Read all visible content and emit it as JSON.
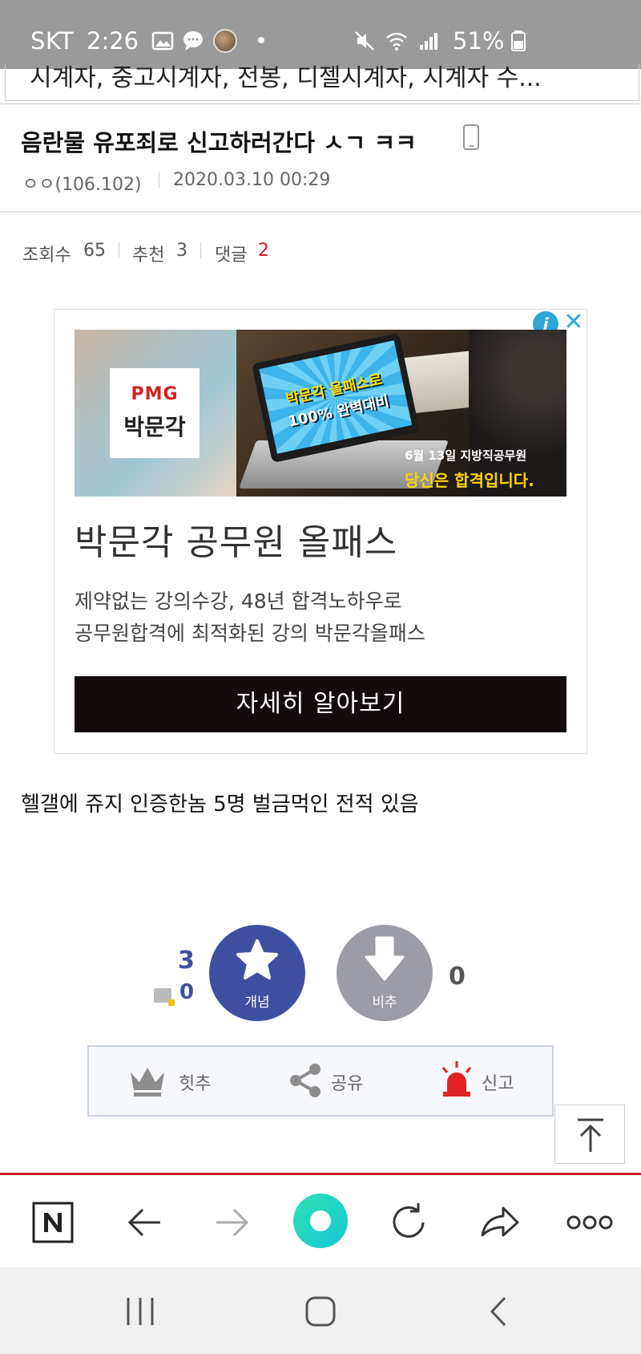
{
  "status_bar": {
    "carrier": "SKT",
    "time": "2:26",
    "battery_percent": "51%",
    "icons": [
      "gallery-icon",
      "message-icon",
      "avatar-icon",
      "mute-icon",
      "wifi-icon",
      "signal-icon",
      "battery-icon"
    ]
  },
  "top_tags": {
    "text": "시계자, 중고시계자, 전봉, 디젤시계자, 시계자 수..."
  },
  "post": {
    "title": "음란물 유포죄로 신고하러간다 ㅅㄱ ㅋㅋ",
    "author": "ㅇㅇ(106.102)",
    "date": "2020.03.10 00:29",
    "views_label": "조회수",
    "views": "65",
    "recommend_label": "추천",
    "recommend": "3",
    "comments_label": "댓글",
    "comments": "2",
    "body": "헬갤에 쥬지 인증한놈 5명 벌금먹인 전적 있음"
  },
  "ad": {
    "info_icon": "info-icon",
    "close_icon": "close-icon",
    "logo_brand": "PMG",
    "logo_name": "박문각",
    "screen_text_1": "박문각 올패스로",
    "screen_text_2": "100% 완벽대비",
    "caption_1": "6월 13일 지방직공무원",
    "caption_2": "당신은 합격입니다.",
    "headline": "박문각 공무원 올패스",
    "body_line_1": "제약없는 강의수강, 48년 합격노하우로",
    "body_line_2": "공무원합격에 최적화된 강의 박문각올패스",
    "cta": "자세히 알아보기"
  },
  "vote": {
    "up_count": "3",
    "fixed_count": "0",
    "up_label": "개념",
    "down_label": "비추",
    "down_count": "0"
  },
  "actions": {
    "hit_label": "힛추",
    "share_label": "공유",
    "report_label": "신고"
  },
  "colors": {
    "accent_blue": "#3f4fa0",
    "red": "#d31a1a",
    "status_bar": "#9a9a9a",
    "browser_home": "#1fd4c0"
  }
}
